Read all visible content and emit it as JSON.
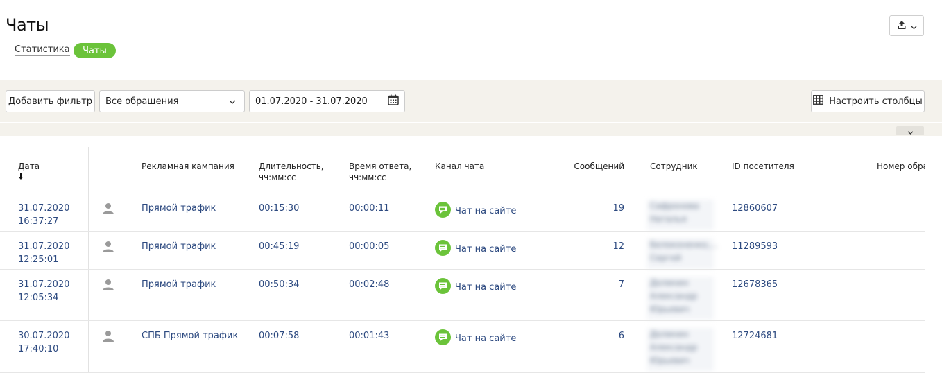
{
  "page": {
    "title": "Чаты"
  },
  "tabs": {
    "stats": "Статистика",
    "chats": "Чаты"
  },
  "filters": {
    "add_filter": "Добавить фильтр",
    "type_select": "Все обращения",
    "date_range": "01.07.2020 - 31.07.2020",
    "configure_columns": "Настроить столбцы"
  },
  "table": {
    "headers": {
      "date": "Дата",
      "campaign": "Рекламная кампания",
      "duration_1": "Длительность,",
      "duration_2": "чч:мм:сс",
      "response_1": "Время ответа,",
      "response_2": "чч:мм:сс",
      "channel": "Канал чата",
      "messages": "Сообщений",
      "employee": "Сотрудник",
      "visitor_id": "ID посетителя",
      "request_no": "Номер обра"
    },
    "rows": [
      {
        "date": "31.07.2020",
        "time": "16:37:27",
        "campaign": "Прямой трафик",
        "duration": "00:15:30",
        "response": "00:00:11",
        "channel": "Чат на сайте",
        "messages": "19",
        "employee_1": "Сафронова",
        "employee_2": "Наталья",
        "employee_3": "",
        "visitor_id": "12860607"
      },
      {
        "date": "31.07.2020",
        "time": "12:25:01",
        "campaign": "Прямой трафик",
        "duration": "00:45:19",
        "response": "00:00:05",
        "channel": "Чат на сайте",
        "messages": "12",
        "employee_1": "Белоконенко,...",
        "employee_2": "Сергей",
        "employee_3": "",
        "visitor_id": "11289593"
      },
      {
        "date": "31.07.2020",
        "time": "12:05:34",
        "campaign": "Прямой трафик",
        "duration": "00:50:34",
        "response": "00:02:48",
        "channel": "Чат на сайте",
        "messages": "7",
        "employee_1": "Долинин",
        "employee_2": "Александр",
        "employee_3": "Юрьевич",
        "visitor_id": "12678365"
      },
      {
        "date": "30.07.2020",
        "time": "17:40:10",
        "campaign": "СПБ Прямой трафик",
        "duration": "00:07:58",
        "response": "00:01:43",
        "channel": "Чат на сайте",
        "messages": "6",
        "employee_1": "Долинин",
        "employee_2": "Александр",
        "employee_3": "Юрьевич",
        "visitor_id": "12724681"
      }
    ]
  },
  "icons": {
    "export": "export-icon",
    "dropdown": "chevron-down-icon",
    "calendar": "calendar-icon",
    "columns": "grid-icon",
    "user": "user-icon",
    "chat": "chat-bubble-icon"
  },
  "colors": {
    "accent_green": "#6bc33a",
    "link_blue": "#2d4a80",
    "filter_bg": "#f4f2ec"
  }
}
